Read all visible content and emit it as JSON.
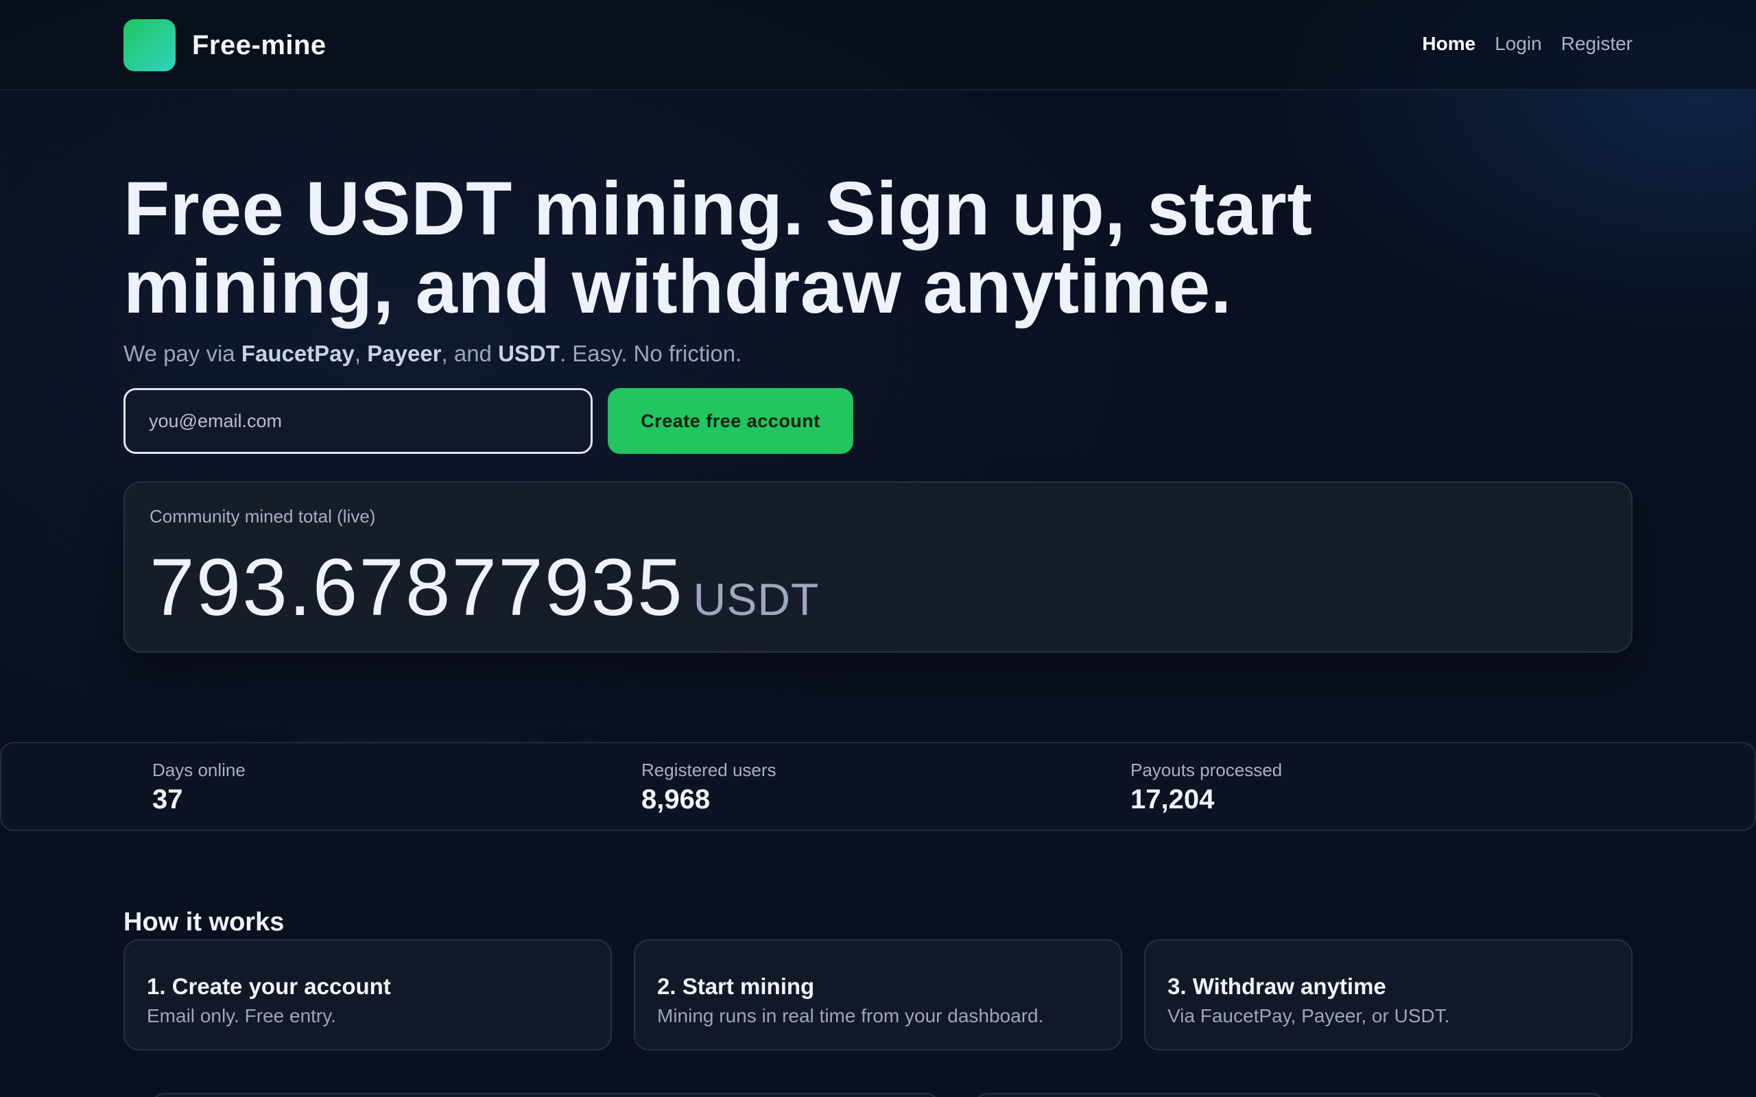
{
  "header": {
    "brand": "Free-mine",
    "nav": [
      {
        "label": "Home",
        "active": true
      },
      {
        "label": "Login",
        "active": false
      },
      {
        "label": "Register",
        "active": false
      }
    ]
  },
  "hero": {
    "title_line1": "Free USDT mining. Sign up, start",
    "title_line2": "mining, and withdraw anytime.",
    "subtitle": {
      "prefix": "We pay via ",
      "method1": "FaucetPay",
      "sep1": ", ",
      "method2": "Payeer",
      "sep2": ", and ",
      "method3": "USDT",
      "suffix": ". Easy. No friction."
    },
    "email_placeholder": "you@email.com",
    "cta_label": "Create free account"
  },
  "mined": {
    "label": "Community mined total (live)",
    "value": "793.67877935",
    "unit": "USDT"
  },
  "stats": [
    {
      "label": "Days online",
      "value": "37"
    },
    {
      "label": "Registered users",
      "value": "8,968"
    },
    {
      "label": "Payouts processed",
      "value": "17,204"
    }
  ],
  "how": {
    "title": "How it works",
    "steps": [
      {
        "title": "1. Create your account",
        "desc": "Email only. Free entry."
      },
      {
        "title": "2. Start mining",
        "desc": "Mining runs in real time from your dashboard."
      },
      {
        "title": "3. Withdraw anytime",
        "desc": "Via FaucetPay, Payeer, or USDT."
      }
    ]
  },
  "colors": {
    "accent": "#22c55e",
    "background": "#0a1020",
    "panel": "#161c28"
  }
}
